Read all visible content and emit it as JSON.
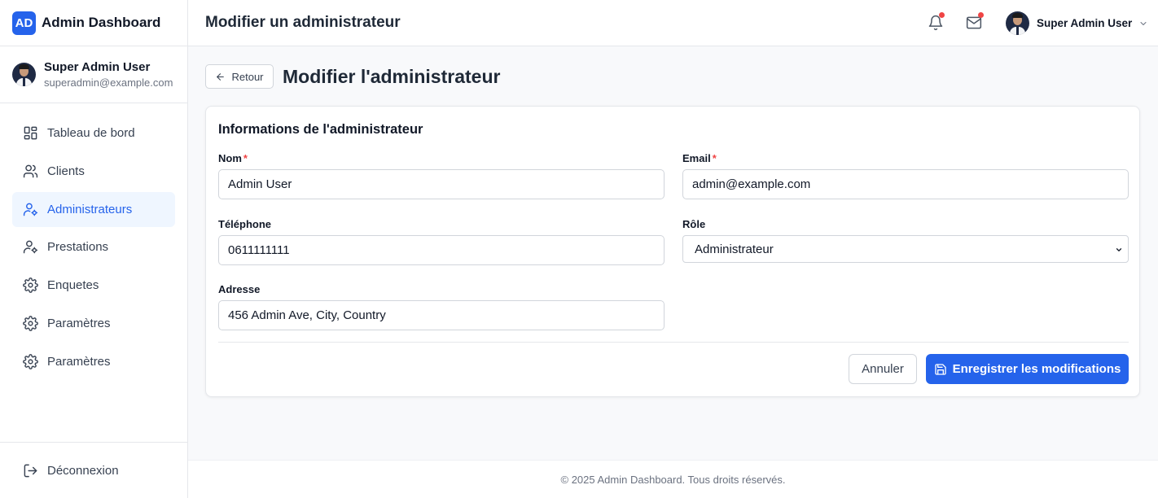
{
  "brand": {
    "logo": "AD",
    "name": "Admin Dashboard"
  },
  "sidebar_profile": {
    "name": "Super Admin User",
    "email": "superadmin@example.com"
  },
  "nav": [
    {
      "label": "Tableau de bord",
      "icon": "dashboard-grid-icon",
      "active": false
    },
    {
      "label": "Clients",
      "icon": "users-icon",
      "active": false
    },
    {
      "label": "Administrateurs",
      "icon": "user-cog-icon",
      "active": true
    },
    {
      "label": "Prestations",
      "icon": "user-cog-icon",
      "active": false
    },
    {
      "label": "Enquetes",
      "icon": "gear-icon",
      "active": false
    },
    {
      "label": "Paramètres",
      "icon": "gear-icon",
      "active": false
    },
    {
      "label": "Paramètres",
      "icon": "gear-icon",
      "active": false
    }
  ],
  "logout": {
    "label": "Déconnexion",
    "icon": "logout-icon"
  },
  "header": {
    "title": "Modifier un administrateur",
    "user_name": "Super Admin User",
    "icons": [
      "bell-icon",
      "mail-icon",
      "chevron-down-icon"
    ]
  },
  "page": {
    "back_label": "Retour",
    "title": "Modifier l'administrateur"
  },
  "form": {
    "section_title": "Informations de l'administrateur",
    "name": {
      "label": "Nom",
      "required_mark": "*",
      "value": "Admin User"
    },
    "email": {
      "label": "Email",
      "required_mark": "*",
      "value": "admin@example.com"
    },
    "phone": {
      "label": "Téléphone",
      "value": "0611111111"
    },
    "role": {
      "label": "Rôle",
      "value": "Administrateur"
    },
    "address": {
      "label": "Adresse",
      "value": "456 Admin Ave, City, Country"
    },
    "cancel_label": "Annuler",
    "save_label": "Enregistrer les modifications"
  },
  "footer": {
    "text": "© 2025 Admin Dashboard. Tous droits réservés."
  },
  "colors": {
    "accent": "#2563eb",
    "active_bg": "#eff6ff",
    "notification_dot": "#ef4444",
    "required": "#ef4444"
  }
}
